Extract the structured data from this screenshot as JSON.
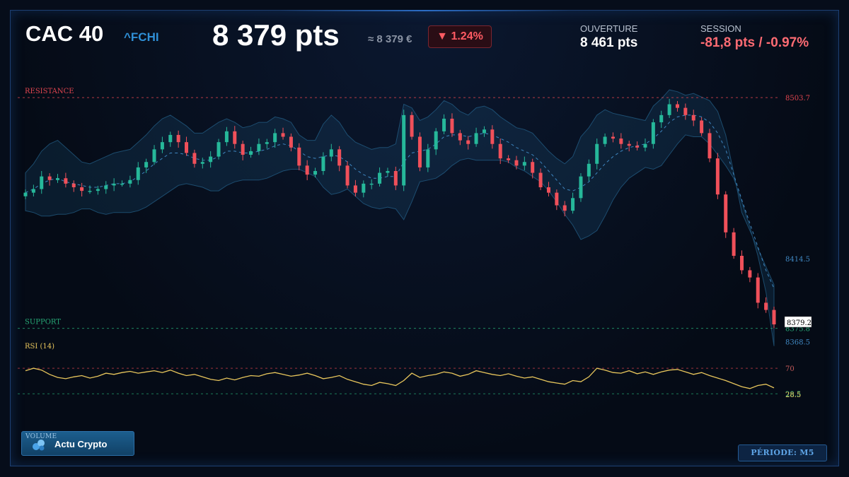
{
  "header": {
    "title": "CAC 40",
    "ticker": "^FCHI",
    "price": "8 379 pts",
    "approx": "≈ 8 379 €",
    "change_badge": "▼ 1.24%"
  },
  "stats": {
    "open_label": "OUVERTURE",
    "open_value": "8 461 pts",
    "session_label": "SESSION",
    "session_value": "-81,8 pts / -0.97%"
  },
  "colors": {
    "up": "#26b89a",
    "down": "#f0505a",
    "rsi": "#e8c65c",
    "resistance": "#e0454f",
    "support": "#27a876",
    "band": "#1f5c86",
    "accent": "#2f8fd6"
  },
  "chart_data": {
    "type": "line",
    "price": {
      "resistance_label": "RESISTANCE",
      "support_label": "SUPPORT",
      "resistance": 8503.7,
      "support": 8375.8,
      "band_mid_label": 8414.5,
      "band_lower_label": 8368.5,
      "last_price": 8379.2,
      "ylim": [
        8360,
        8510
      ],
      "close": [
        8451,
        8453,
        8460,
        8458,
        8459,
        8456,
        8454,
        8452,
        8452,
        8453,
        8455,
        8456,
        8456,
        8458,
        8465,
        8468,
        8475,
        8479,
        8483,
        8479,
        8473,
        8467,
        8468,
        8471,
        8479,
        8485,
        8478,
        8472,
        8474,
        8478,
        8479,
        8484,
        8482,
        8476,
        8466,
        8461,
        8463,
        8471,
        8475,
        8466,
        8455,
        8451,
        8456,
        8456,
        8462,
        8463,
        8455,
        8494,
        8482,
        8465,
        8475,
        8485,
        8492,
        8484,
        8480,
        8478,
        8484,
        8486,
        8478,
        8470,
        8469,
        8466,
        8468,
        8462,
        8454,
        8451,
        8444,
        8441,
        8448,
        8460,
        8467,
        8478,
        8482,
        8481,
        8478,
        8477,
        8476,
        8478,
        8490,
        8494,
        8500,
        8498,
        8494,
        8491,
        8484,
        8470,
        8450,
        8429,
        8416,
        8408,
        8404,
        8390,
        8386,
        8378
      ],
      "band_upper": [
        8462,
        8467,
        8474,
        8478,
        8480,
        8476,
        8472,
        8468,
        8467,
        8469,
        8471,
        8473,
        8474,
        8475,
        8479,
        8483,
        8488,
        8492,
        8494,
        8491,
        8488,
        8484,
        8484,
        8487,
        8490,
        8492,
        8490,
        8487,
        8488,
        8490,
        8490,
        8493,
        8492,
        8490,
        8483,
        8480,
        8480,
        8489,
        8494,
        8490,
        8483,
        8479,
        8477,
        8475,
        8476,
        8476,
        8478,
        8500,
        8498,
        8491,
        8493,
        8497,
        8502,
        8500,
        8496,
        8494,
        8498,
        8499,
        8497,
        8493,
        8490,
        8487,
        8486,
        8484,
        8479,
        8474,
        8470,
        8467,
        8471,
        8482,
        8487,
        8494,
        8497,
        8495,
        8494,
        8493,
        8492,
        8491,
        8499,
        8503,
        8508,
        8507,
        8505,
        8506,
        8504,
        8502,
        8496,
        8483,
        8462,
        8440,
        8430,
        8420,
        8410,
        8400
      ],
      "band_mid": [
        8451,
        8453,
        8456,
        8458,
        8459,
        8457,
        8456,
        8455,
        8454,
        8454,
        8455,
        8456,
        8456,
        8457,
        8460,
        8463,
        8467,
        8470,
        8473,
        8473,
        8472,
        8470,
        8469,
        8469,
        8471,
        8474,
        8474,
        8473,
        8473,
        8474,
        8475,
        8477,
        8478,
        8477,
        8474,
        8471,
        8470,
        8471,
        8472,
        8471,
        8468,
        8464,
        8461,
        8459,
        8459,
        8460,
        8460,
        8468,
        8473,
        8474,
        8475,
        8478,
        8482,
        8483,
        8483,
        8482,
        8483,
        8484,
        8483,
        8481,
        8479,
        8476,
        8474,
        8472,
        8468,
        8463,
        8458,
        8453,
        8452,
        8454,
        8457,
        8462,
        8467,
        8471,
        8474,
        8476,
        8477,
        8478,
        8481,
        8485,
        8490,
        8493,
        8494,
        8494,
        8493,
        8490,
        8484,
        8475,
        8461,
        8447,
        8434,
        8421,
        8408,
        8398
      ],
      "band_lower": [
        8441,
        8440,
        8438,
        8438,
        8439,
        8439,
        8440,
        8442,
        8442,
        8440,
        8439,
        8440,
        8440,
        8440,
        8441,
        8443,
        8446,
        8449,
        8452,
        8455,
        8456,
        8455,
        8454,
        8452,
        8452,
        8455,
        8457,
        8458,
        8458,
        8458,
        8459,
        8461,
        8463,
        8464,
        8464,
        8462,
        8460,
        8454,
        8450,
        8451,
        8453,
        8449,
        8445,
        8443,
        8442,
        8443,
        8442,
        8436,
        8446,
        8457,
        8458,
        8459,
        8462,
        8466,
        8469,
        8470,
        8469,
        8469,
        8469,
        8469,
        8468,
        8465,
        8463,
        8460,
        8457,
        8452,
        8446,
        8439,
        8433,
        8425,
        8427,
        8430,
        8438,
        8447,
        8454,
        8459,
        8462,
        8465,
        8464,
        8466,
        8472,
        8478,
        8483,
        8482,
        8482,
        8478,
        8472,
        8466,
        8459,
        8446,
        8432,
        8416,
        8396,
        8366
      ]
    },
    "rsi": {
      "label": "RSI (14)",
      "overbought": 70,
      "oversold": 28.5,
      "last": 28.5,
      "values": [
        66,
        70,
        67,
        60,
        55,
        53,
        56,
        58,
        54,
        57,
        62,
        60,
        63,
        65,
        62,
        64,
        66,
        63,
        67,
        62,
        58,
        60,
        56,
        52,
        50,
        54,
        51,
        55,
        58,
        57,
        61,
        63,
        60,
        57,
        59,
        62,
        58,
        53,
        55,
        58,
        52,
        48,
        44,
        42,
        47,
        45,
        42,
        50,
        62,
        55,
        58,
        60,
        64,
        62,
        57,
        60,
        66,
        63,
        60,
        58,
        61,
        57,
        54,
        56,
        52,
        48,
        46,
        44,
        50,
        48,
        56,
        70,
        67,
        63,
        62,
        66,
        61,
        64,
        60,
        64,
        67,
        68,
        64,
        60,
        63,
        58,
        54,
        50,
        45,
        40,
        37,
        42,
        44,
        38
      ]
    }
  },
  "footer": {
    "volume_label": "VOLUME",
    "button_label": "Actu Crypto",
    "period_label": "PÉRIODE: M5"
  }
}
